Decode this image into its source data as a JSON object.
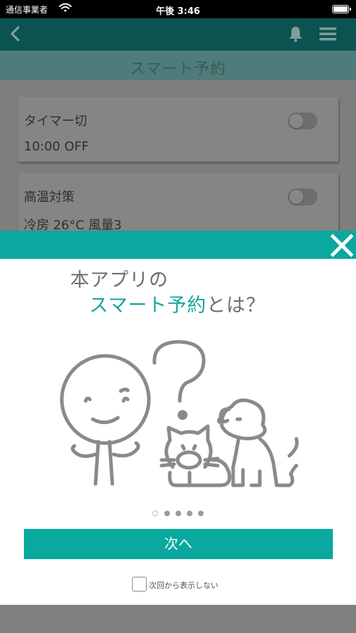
{
  "status_bar": {
    "carrier": "通信事業者",
    "time": "午後 3:46",
    "wifi_icon": "wifi-icon",
    "battery_icon": "battery-icon"
  },
  "app_header": {
    "back_icon": "back-chevron-icon",
    "bell_icon": "bell-icon",
    "menu_icon": "hamburger-menu-icon",
    "title": "スマート予約"
  },
  "reservations": [
    {
      "name": "タイマー切",
      "value": "10:00 OFF",
      "enabled": false
    },
    {
      "name": "高温対策",
      "value": "冷房 26°C 風量3",
      "enabled": false
    }
  ],
  "modal": {
    "close_icon": "close-x-icon",
    "heading_line1": "本アプリの",
    "heading_accent": "スマート予約",
    "heading_rest": "とは？",
    "illustration": "person-question-cat-dog-illustration",
    "page_indicator": {
      "total": 5,
      "current": 1
    },
    "next_button": "次へ",
    "dont_show_label": "次回から表示しない",
    "dont_show_checked": false
  },
  "colors": {
    "accent": "#0aa89e",
    "accent_text": "#16a49c",
    "overlay": "#7f7f7f"
  }
}
